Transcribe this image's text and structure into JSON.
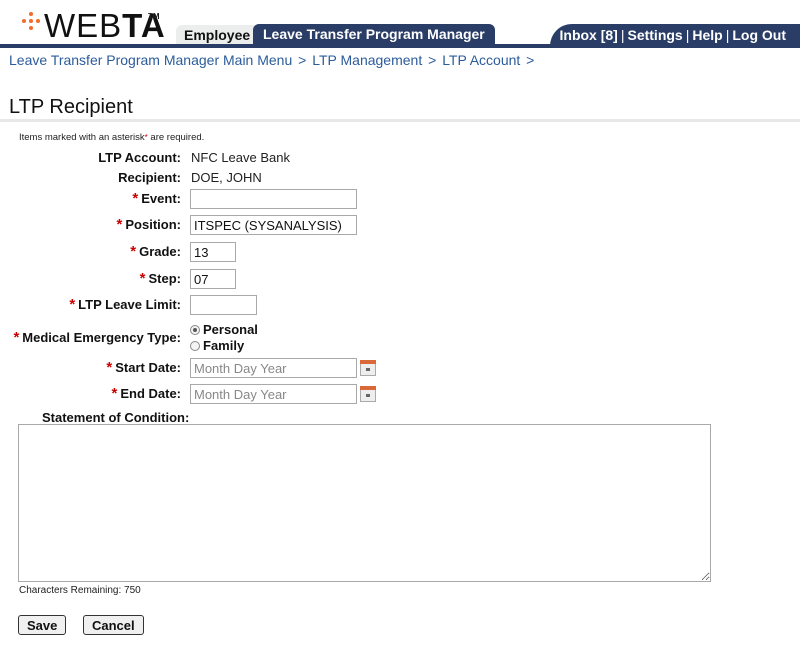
{
  "header": {
    "logo_text_light": "WEB",
    "logo_text_bold": "TA",
    "logo_tm": "TM",
    "tabs": [
      {
        "label": "Employee",
        "active": false
      },
      {
        "label": "Leave Transfer Program Manager",
        "active": true
      }
    ],
    "utility_links": [
      {
        "label": "Inbox [8]"
      },
      {
        "label": "Settings"
      },
      {
        "label": "Help"
      },
      {
        "label": "Log Out"
      }
    ],
    "separator": "|"
  },
  "breadcrumb": {
    "items": [
      "Leave Transfer Program Manager Main Menu",
      "LTP Management",
      "LTP Account"
    ],
    "separator": ">"
  },
  "page": {
    "title": "LTP Recipient",
    "required_note_prefix": "Items marked with an asterisk",
    "required_note_asterisk": "*",
    "required_note_suffix": " are required."
  },
  "form": {
    "ltp_account": {
      "label": "LTP Account:",
      "value": "NFC Leave Bank"
    },
    "recipient": {
      "label": "Recipient:",
      "value": "DOE, JOHN"
    },
    "event": {
      "label": "Event:",
      "value": "",
      "required": true
    },
    "position": {
      "label": "Position:",
      "value": "ITSPEC (SYSANALYSIS)",
      "required": true
    },
    "grade": {
      "label": "Grade:",
      "value": "13",
      "required": true
    },
    "step": {
      "label": "Step:",
      "value": "07",
      "required": true
    },
    "leave_limit": {
      "label": "LTP Leave Limit:",
      "value": "",
      "required": true
    },
    "medical_type": {
      "label": "Medical Emergency Type:",
      "required": true,
      "options": [
        "Personal",
        "Family"
      ],
      "selected": "Personal"
    },
    "start_date": {
      "label": "Start Date:",
      "value": "",
      "placeholder": "Month Day Year",
      "required": true
    },
    "end_date": {
      "label": "End Date:",
      "value": "",
      "placeholder": "Month Day Year",
      "required": true
    },
    "statement": {
      "label": "Statement of Condition:",
      "value": ""
    },
    "chars_remaining_label": "Characters Remaining: 750",
    "asterisk": "*"
  },
  "buttons": {
    "save": "Save",
    "cancel": "Cancel"
  }
}
